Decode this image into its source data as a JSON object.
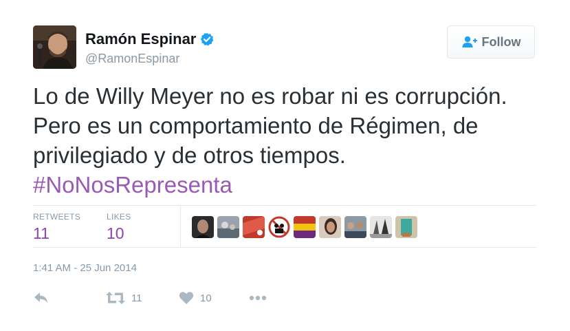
{
  "author": {
    "name": "Ramón Espinar",
    "handle": "@RamonEspinar",
    "verified": true
  },
  "follow_button": {
    "label": "Follow"
  },
  "tweet": {
    "text": "Lo de Willy Meyer no es robar ni es corrupción. Pero es un comportamiento de Régimen, de privilegiado y de otros tiempos.",
    "hashtag": "#NoNosRepresenta"
  },
  "stats": {
    "retweets_label": "RETWEETS",
    "retweets_count": "11",
    "likes_label": "LIKES",
    "likes_count": "10"
  },
  "timestamp": "1:41 AM - 25 Jun 2014",
  "actions": {
    "retweet_count": "11",
    "like_count": "10"
  },
  "colors": {
    "hashtag": "#9b59b6",
    "stat_value": "#8e44ad",
    "verified": "#1da1f2",
    "muted": "#8899a6"
  }
}
